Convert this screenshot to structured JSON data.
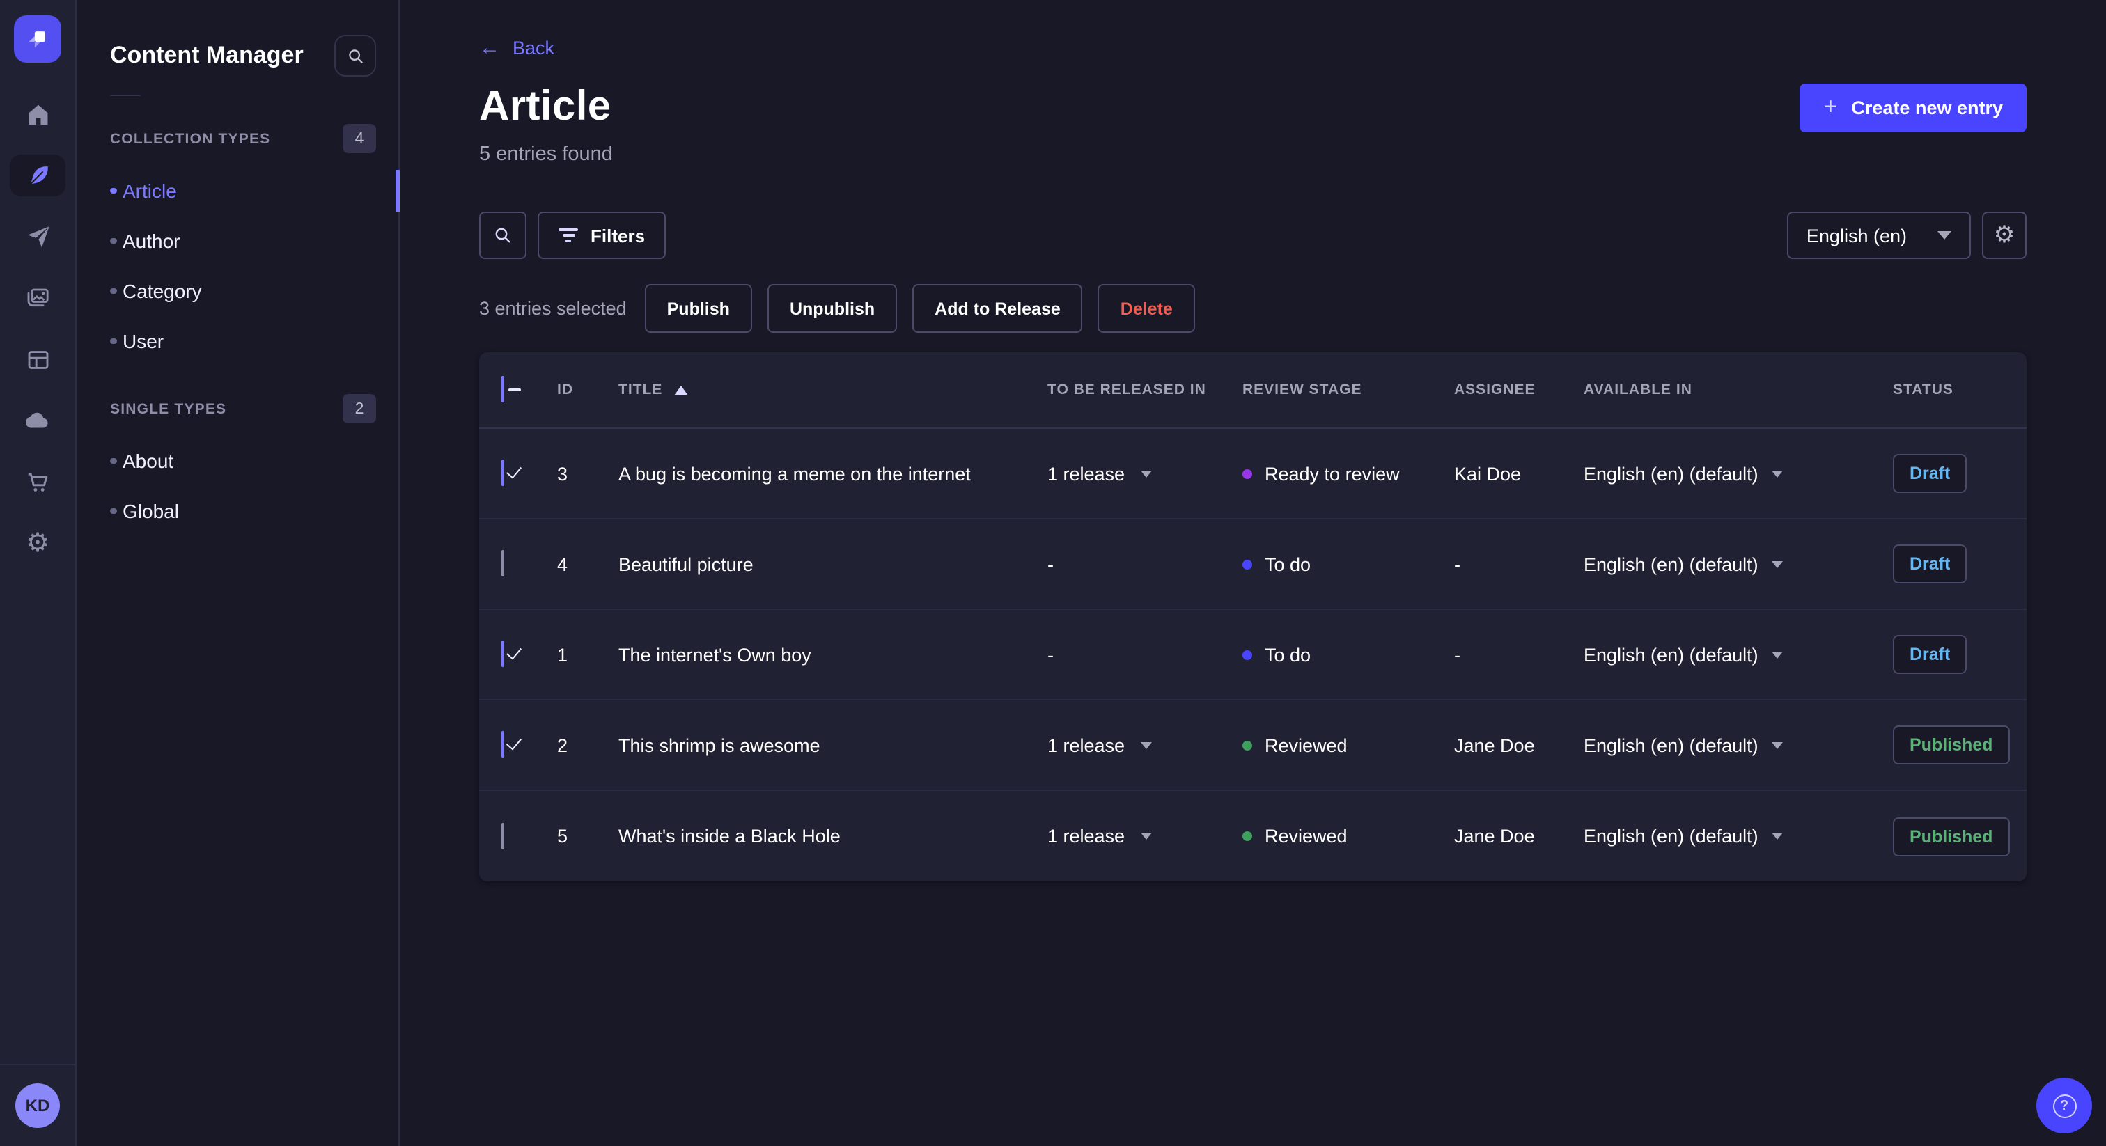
{
  "app": {
    "name": "Strapi"
  },
  "rail": {
    "items": [
      {
        "label": "Home",
        "icon": "home-icon",
        "active": false
      },
      {
        "label": "Content Manager",
        "icon": "feather-icon",
        "active": true
      },
      {
        "label": "Releases",
        "icon": "paper-plane-icon",
        "active": false
      },
      {
        "label": "Media Library",
        "icon": "media-icon",
        "active": false
      },
      {
        "label": "Content-Type Builder",
        "icon": "layout-icon",
        "active": false
      },
      {
        "label": "Deploy",
        "icon": "cloud-icon",
        "active": false
      },
      {
        "label": "Marketplace",
        "icon": "cart-icon",
        "active": false
      },
      {
        "label": "Settings",
        "icon": "gear-icon",
        "active": false
      }
    ],
    "gear_glyph": "⚙",
    "avatar_initials": "KD"
  },
  "sidebar": {
    "title": "Content Manager",
    "sections": [
      {
        "label": "COLLECTION TYPES",
        "count": "4",
        "items": [
          {
            "label": "Article",
            "active": true
          },
          {
            "label": "Author"
          },
          {
            "label": "Category"
          },
          {
            "label": "User"
          }
        ]
      },
      {
        "label": "SINGLE TYPES",
        "count": "2",
        "items": [
          {
            "label": "About"
          },
          {
            "label": "Global"
          }
        ]
      }
    ]
  },
  "header": {
    "back_label": "Back",
    "back_arrow": "←",
    "title": "Article",
    "subtitle": "5 entries found",
    "create_button": "Create new entry",
    "plus_glyph": "+"
  },
  "toolbar": {
    "filters_label": "Filters",
    "locale": "English (en)",
    "gear_glyph": "⚙"
  },
  "selection": {
    "summary": "3 entries selected",
    "publish": "Publish",
    "unpublish": "Unpublish",
    "add_to_release": "Add to Release",
    "delete": "Delete"
  },
  "table": {
    "columns": {
      "id": "ID",
      "title": "TITLE",
      "release": "TO BE RELEASED IN",
      "stage": "REVIEW STAGE",
      "assignee": "ASSIGNEE",
      "available": "AVAILABLE IN",
      "status": "STATUS"
    },
    "rows": [
      {
        "selected": true,
        "id": "3",
        "title": "A bug is becoming a meme on the internet",
        "release": "1 release",
        "stage": "Ready to review",
        "stage_color": "#9736e8",
        "assignee": "Kai Doe",
        "available": "English (en) (default)",
        "status": "Draft"
      },
      {
        "selected": false,
        "id": "4",
        "title": "Beautiful picture",
        "release": "-",
        "stage": "To do",
        "stage_color": "#4945ff",
        "assignee": "-",
        "available": "English (en) (default)",
        "status": "Draft"
      },
      {
        "selected": true,
        "id": "1",
        "title": "The internet's Own boy",
        "release": "-",
        "stage": "To do",
        "stage_color": "#4945ff",
        "assignee": "-",
        "available": "English (en) (default)",
        "status": "Draft"
      },
      {
        "selected": true,
        "id": "2",
        "title": "This shrimp is awesome",
        "release": "1 release",
        "stage": "Reviewed",
        "stage_color": "#3e9e5c",
        "assignee": "Jane Doe",
        "available": "English (en) (default)",
        "status": "Published"
      },
      {
        "selected": false,
        "id": "5",
        "title": "What's inside a Black Hole",
        "release": "1 release",
        "stage": "Reviewed",
        "stage_color": "#3e9e5c",
        "assignee": "Jane Doe",
        "available": "English (en) (default)",
        "status": "Published"
      }
    ]
  },
  "help": {
    "glyph": "?"
  },
  "colors": {
    "primary": "#4945ff",
    "primary_light": "#7b79ff",
    "draft": "#66b7f1",
    "published": "#5cb176",
    "danger": "#ee5e52"
  }
}
